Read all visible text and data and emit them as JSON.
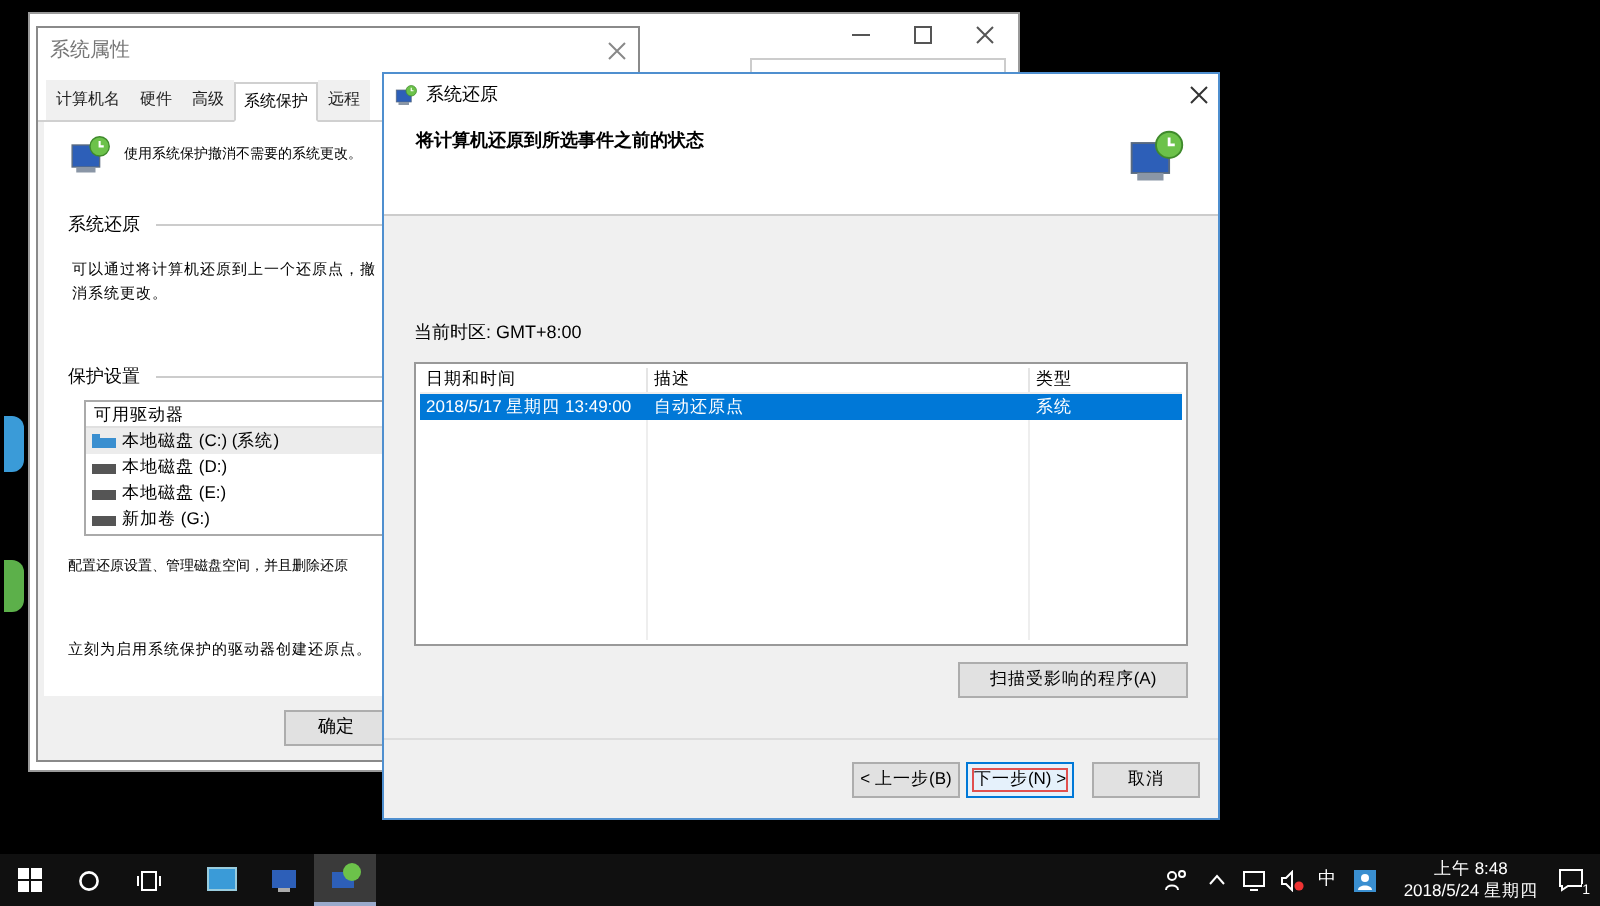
{
  "system_properties": {
    "title": "系统属性",
    "tabs": [
      {
        "label": "计算机名",
        "selected": false
      },
      {
        "label": "硬件",
        "selected": false
      },
      {
        "label": "高级",
        "selected": false
      },
      {
        "label": "系统保护",
        "selected": true
      },
      {
        "label": "远程",
        "selected": false
      }
    ],
    "intro": "使用系统保护撤消不需要的系统更改。",
    "restore_heading": "系统还原",
    "restore_text": "可以通过将计算机还原到上一个还原点，撤消系统更改。",
    "protection_heading": "保护设置",
    "drives_header": "可用驱动器",
    "drives": [
      {
        "name": "本地磁盘 (C:) (系统)",
        "kind": "system",
        "selected": true
      },
      {
        "name": "本地磁盘 (D:)",
        "kind": "disk",
        "selected": false
      },
      {
        "name": "本地磁盘 (E:)",
        "kind": "disk",
        "selected": false
      },
      {
        "name": "新加卷 (G:)",
        "kind": "disk",
        "selected": false
      }
    ],
    "configure_text": "配置还原设置、管理磁盘空间，并且删除还原",
    "create_text": "立刻为启用系统保护的驱动器创建还原点。",
    "ok_button": "确定"
  },
  "restore_dialog": {
    "title": "系统还原",
    "heading": "将计算机还原到所选事件之前的状态",
    "timezone": "当前时区: GMT+8:00",
    "columns": [
      "日期和时间",
      "描述",
      "类型"
    ],
    "rows": [
      {
        "cells": [
          "2018/5/17 星期四 13:49:00",
          "自动还原点",
          "系统"
        ],
        "selected": true
      }
    ],
    "scan_button": "扫描受影响的程序(A)",
    "buttons": [
      {
        "label": "< 上一步(B)",
        "focused": false
      },
      {
        "label": "下一步(N) >",
        "focused": true
      },
      {
        "label": "取消",
        "focused": false
      }
    ]
  },
  "taskbar": {
    "apps": [
      {
        "kind": "control",
        "selected": false
      },
      {
        "kind": "system",
        "selected": false
      },
      {
        "kind": "restore",
        "selected": true
      }
    ],
    "ime": "中",
    "time": "上午 8:48",
    "date": "2018/5/24 星期四",
    "notifications": "1"
  }
}
